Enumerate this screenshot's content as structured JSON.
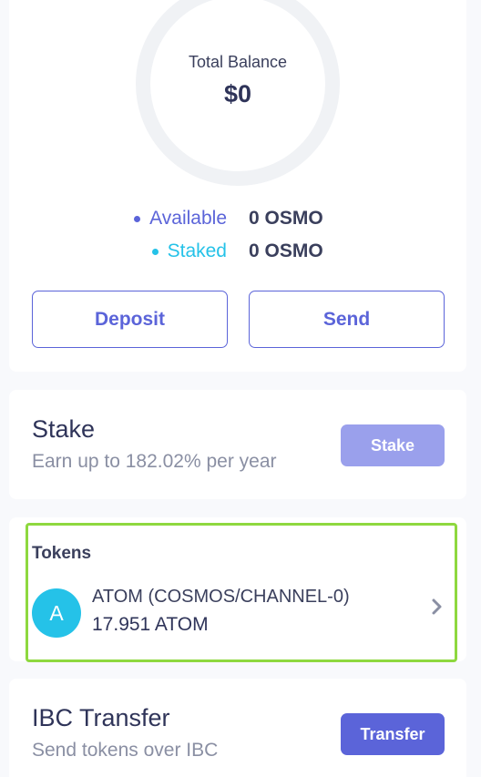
{
  "balance": {
    "total_label": "Total Balance",
    "total_value": "$0",
    "available_label": "Available",
    "available_value": "0 OSMO",
    "staked_label": "Staked",
    "staked_value": "0 OSMO",
    "deposit_label": "Deposit",
    "send_label": "Send",
    "colors": {
      "available": "#5b64d9",
      "staked": "#25c2e8"
    }
  },
  "stake": {
    "title": "Stake",
    "subtitle": "Earn up to 182.02% per year",
    "button_label": "Stake"
  },
  "tokens": {
    "heading": "Tokens",
    "items": [
      {
        "avatar": "A",
        "name": "ATOM (COSMOS/CHANNEL-0)",
        "amount": "17.951 ATOM",
        "icon": "chevron-right-icon"
      }
    ]
  },
  "ibc": {
    "title": "IBC Transfer",
    "subtitle": "Send tokens over IBC",
    "button_label": "Transfer"
  }
}
